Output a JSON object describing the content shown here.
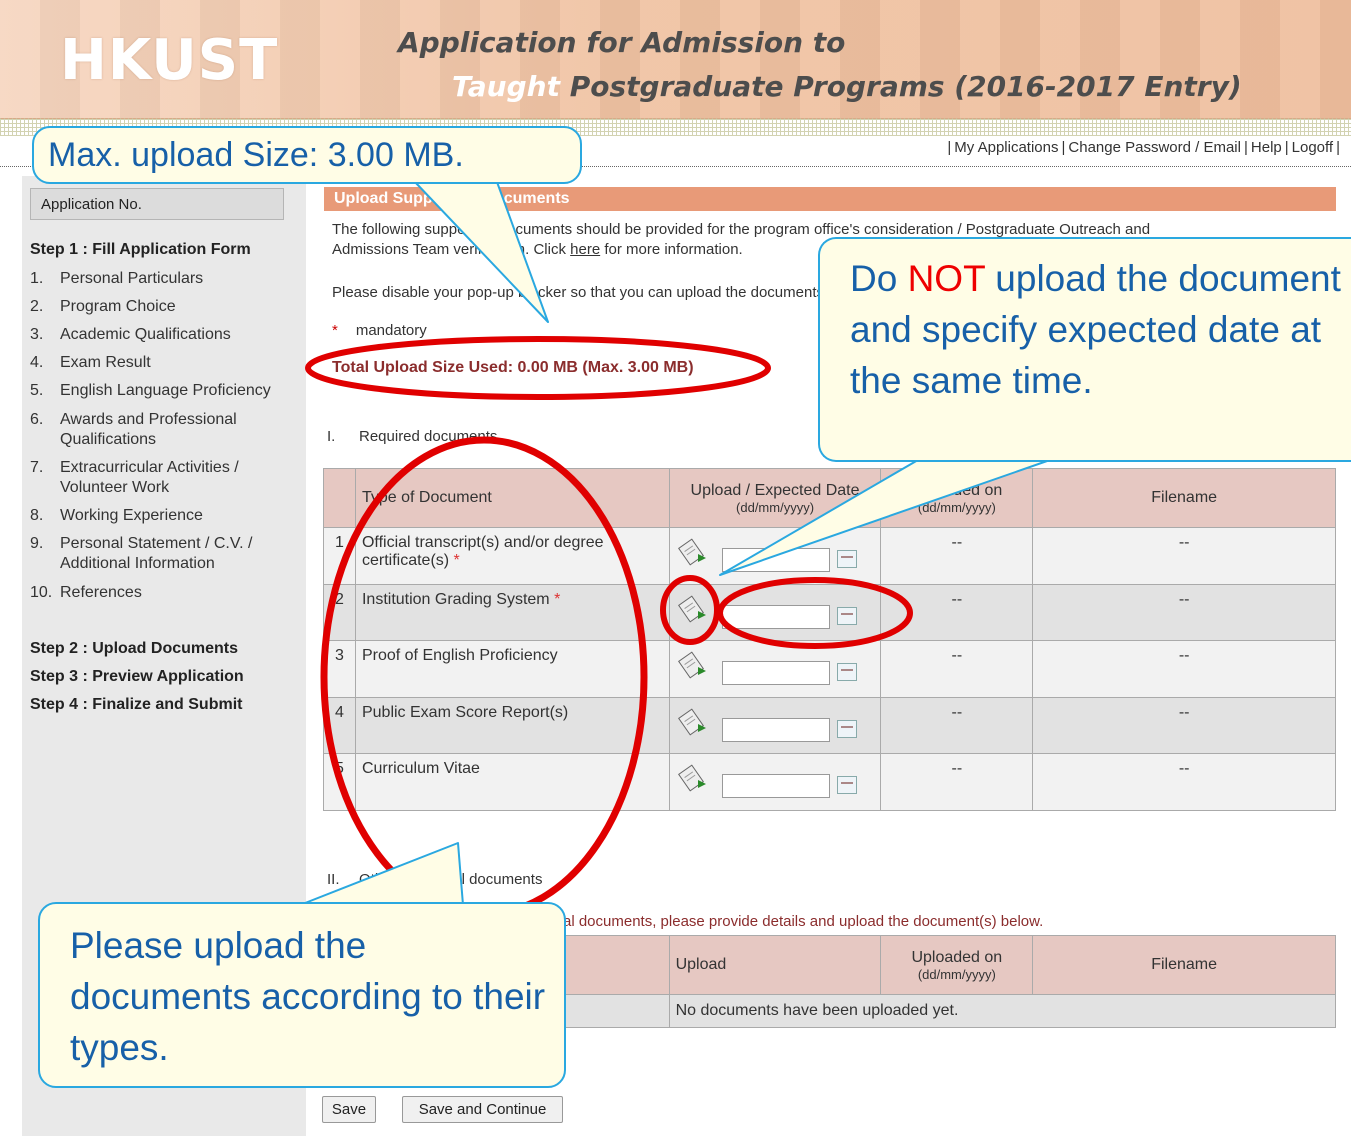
{
  "header": {
    "logo": "HKUST",
    "title_line1": "Application for Admission to",
    "title_line2_highlight": "Taught",
    "title_line2_rest": " Postgraduate Programs (2016-2017 Entry)"
  },
  "top_links": [
    "My Applications",
    "Change Password / Email",
    "Help",
    "Logoff"
  ],
  "sidebar": {
    "application_no_label": "Application No.",
    "step1": "Step 1 : Fill Application Form",
    "items": [
      {
        "num": "1.",
        "label": "Personal Particulars"
      },
      {
        "num": "2.",
        "label": "Program Choice"
      },
      {
        "num": "3.",
        "label": "Academic Qualifications"
      },
      {
        "num": "4.",
        "label": "Exam Result"
      },
      {
        "num": "5.",
        "label": "English Language Proficiency"
      },
      {
        "num": "6.",
        "label": "Awards and Professional Qualifications"
      },
      {
        "num": "7.",
        "label": "Extracurricular Activities / Volunteer Work"
      },
      {
        "num": "8.",
        "label": "Working Experience"
      },
      {
        "num": "9.",
        "label": "Personal Statement / C.V. / Additional Information"
      },
      {
        "num": "10.",
        "label": "References"
      }
    ],
    "step2": "Step 2 : Upload Documents",
    "step3": "Step 3 : Preview Application",
    "step4": "Step 4 : Finalize and Submit"
  },
  "main": {
    "section_title": "Upload Supporting Documents",
    "intro_line1": "The following supporting documents should be provided for the program office's consideration / Postgraduate Outreach and",
    "intro_line2_pre": "Admissions Team verification. Click ",
    "intro_link": "here",
    "intro_line2_post": " for more information.",
    "popup_note": "Please disable your pop-up blocker so that you can upload the documents.",
    "mandatory_star": "*",
    "mandatory_label": "mandatory",
    "total_upload": "Total Upload Size Used: 0.00 MB (Max. 3.00 MB)",
    "required_roman": "I.",
    "required_title": "Required documents",
    "required_headers": {
      "type": "Type of Document",
      "upload": "Upload / Expected Date",
      "upload_sub": "(dd/mm/yyyy)",
      "uploaded": "Uploaded on",
      "uploaded_sub": "(dd/mm/yyyy)",
      "filename": "Filename"
    },
    "required_rows": [
      {
        "num": "1",
        "type": "Official transcript(s) and/or degree certificate(s)",
        "required": true,
        "uploaded": "--",
        "filename": "--"
      },
      {
        "num": "2",
        "type": "Institution Grading System",
        "required": true,
        "uploaded": "--",
        "filename": "--"
      },
      {
        "num": "3",
        "type": "Proof of English Proficiency",
        "required": false,
        "uploaded": "--",
        "filename": "--"
      },
      {
        "num": "4",
        "type": "Public Exam Score Report(s)",
        "required": false,
        "uploaded": "--",
        "filename": "--"
      },
      {
        "num": "5",
        "type": "Curriculum Vitae",
        "required": false,
        "uploaded": "--",
        "filename": "--"
      }
    ],
    "required_star": "*",
    "other_roman": "II.",
    "other_title": "Other additional documents",
    "other_instruction": "al documents, please provide details and upload the document(s) below.",
    "other_headers": {
      "upload": "Upload",
      "uploaded": "Uploaded on",
      "uploaded_sub": "(dd/mm/yyyy)",
      "filename": "Filename"
    },
    "other_empty": "No documents have been uploaded yet.",
    "save_label": "Save",
    "save_continue_label": "Save and Continue"
  },
  "callouts": {
    "max_size": "Max. upload Size: 3.00 MB.",
    "do_not_pre": "Do ",
    "do_not_red": "NOT",
    "do_not_post": " upload the document and specify expected date at the same time.",
    "upload_by_type": "Please upload the documents according to their types."
  },
  "colors": {
    "header_bg": "#f0c2a2",
    "section_head": "#e89a78",
    "table_head": "#e6c8c2",
    "total_text": "#8b2d2d",
    "callout_border": "#2aa8e0",
    "callout_text": "#1760a8",
    "annotation_red": "#e00000"
  }
}
